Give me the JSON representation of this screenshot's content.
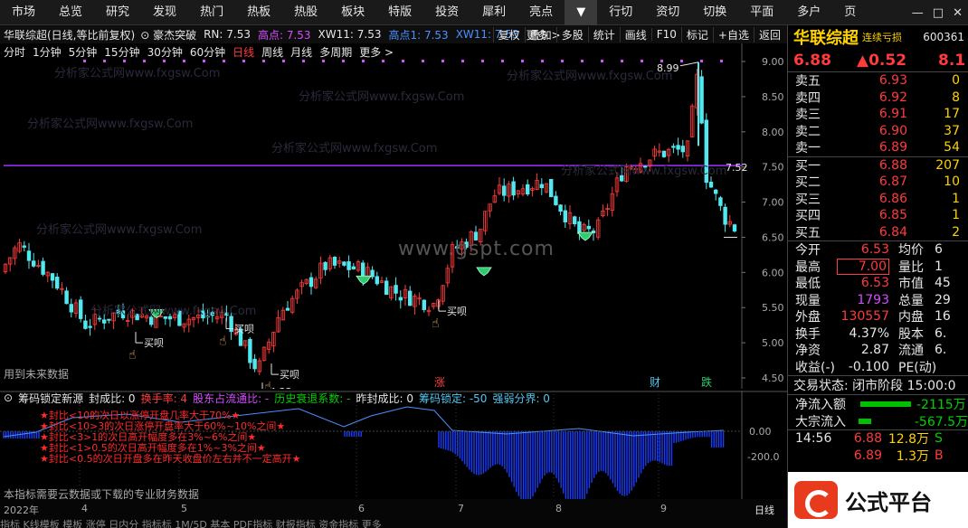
{
  "top_menu": [
    "市场",
    "总览",
    "研究",
    "发现",
    "热门",
    "热板",
    "热股",
    "板块",
    "特版",
    "投资",
    "犀利",
    "亮点",
    "▼",
    "行切",
    "资切",
    "切换",
    "平面",
    "多户",
    "页"
  ],
  "window_controls": [
    "—",
    "□",
    "✕"
  ],
  "toolbar": {
    "title": "华联综超(日线,等比前复权)",
    "indicator": "豪杰突破",
    "rn": "RN: 7.53",
    "high": "高点: 7.53",
    "xw": "XW11: 7.53",
    "high2": "高点1: 7.53",
    "xw2": "XW11: 7.53",
    "more": "更多 >",
    "right_buttons": [
      "复权",
      "叠加",
      "多股",
      "统计",
      "画线",
      "F10",
      "标记",
      "+自选",
      "返回"
    ]
  },
  "periods": [
    "分时",
    "1分钟",
    "5分钟",
    "15分钟",
    "30分钟",
    "60分钟",
    "日线",
    "周线",
    "月线",
    "多周期",
    "更多 >"
  ],
  "active_period": "日线",
  "main_chart": {
    "y_labels": [
      "9.00",
      "8.50",
      "8.00",
      "7.50",
      "7.00",
      "6.50",
      "6.00",
      "5.50",
      "5.00",
      "4.50"
    ],
    "hline_label": "7.52",
    "annotations": {
      "high": "8.99",
      "low": "4.33",
      "buy": "买呗",
      "future_note": "用到未来数据",
      "markers": [
        "涨",
        "财",
        "跌"
      ]
    },
    "watermark": "分析家公式网www.fxgsw.Com",
    "site_watermark": "www.gspt.com"
  },
  "sub_chart": {
    "header": {
      "name": "筹码锁定新源",
      "seal": "封成比: 0",
      "turnover": "换手率: 4",
      "float": "股东占流通比: -",
      "history": "历史衰退系数: -",
      "prev": "昨封成比: 0",
      "lock": "筹码锁定: -50",
      "boundary": "强弱分界: 0"
    },
    "y_labels": [
      "0.00",
      "-200.0"
    ],
    "notes": [
      "★封比<10的次日以涨停开盘几率大于70%★",
      "★封比<10>3的次日涨停开盘率大于60%~10%之间★",
      "★封比<3>1的次日高开幅度多在3%~6%之间★",
      "★封比<1>0.5的次日高开幅度多在1%~3%之间★",
      "★封比<0.5的次日开盘多在昨天收盘价左右并不一定高开★"
    ],
    "footer_note": "本指标需要云数据或下载的专业财务数据"
  },
  "bottom": {
    "year": "2022年",
    "months": [
      "4",
      "5",
      "6",
      "7",
      "8",
      "9"
    ],
    "tab": "日线",
    "line2": "指标 K线模板 模板 涨停 日内分 指标标 1M/5D 基本 PDF指标 财报指标 资金指标 更多"
  },
  "quote": {
    "name": "华联综超",
    "tag": "连续亏损",
    "code": "600361",
    "price": "6.88",
    "change": "▲0.52",
    "pct": "8.1",
    "asks": [
      {
        "label": "卖五",
        "price": "6.93",
        "vol": "0"
      },
      {
        "label": "卖四",
        "price": "6.92",
        "vol": "8"
      },
      {
        "label": "卖三",
        "price": "6.91",
        "vol": "17"
      },
      {
        "label": "卖二",
        "price": "6.90",
        "vol": "37"
      },
      {
        "label": "卖一",
        "price": "6.89",
        "vol": "54"
      }
    ],
    "bids": [
      {
        "label": "买一",
        "price": "6.88",
        "vol": "207"
      },
      {
        "label": "买二",
        "price": "6.87",
        "vol": "10"
      },
      {
        "label": "买三",
        "price": "6.86",
        "vol": "1"
      },
      {
        "label": "买四",
        "price": "6.85",
        "vol": "1"
      },
      {
        "label": "买五",
        "price": "6.84",
        "vol": "2"
      }
    ],
    "stats": [
      {
        "l1": "今开",
        "v1": "6.53",
        "c1": "red",
        "l2": "均价",
        "v2": "6"
      },
      {
        "l1": "最高",
        "v1": "7.00",
        "c1": "red",
        "l2": "量比",
        "v2": "1"
      },
      {
        "l1": "最低",
        "v1": "6.53",
        "c1": "red",
        "l2": "市值",
        "v2": "45"
      },
      {
        "l1": "现量",
        "v1": "1793",
        "c1": "purple",
        "l2": "总量",
        "v2": "29"
      },
      {
        "l1": "外盘",
        "v1": "130557",
        "c1": "red",
        "l2": "内盘",
        "v2": "16"
      },
      {
        "l1": "换手",
        "v1": "4.37%",
        "c1": "white",
        "l2": "股本",
        "v2": "6."
      },
      {
        "l1": "净资",
        "v1": "2.87",
        "c1": "white",
        "l2": "流通",
        "v2": "6."
      },
      {
        "l1": "收益(-)",
        "v1": "-0.100",
        "c1": "white",
        "l2": "PE(动)",
        "v2": ""
      }
    ],
    "trade_state": "交易状态: 闭市阶段 15:00:0",
    "net_inflow": {
      "label": "净流入额",
      "value": "-2115万"
    },
    "big_inflow": {
      "label": "大宗流入",
      "value": "-567.5万"
    },
    "ticks": [
      {
        "time": "14:56",
        "price": "6.88",
        "vol": "12.8万",
        "side": "S"
      },
      {
        "time": "",
        "price": "6.89",
        "vol": "1.3万",
        "side": "B"
      }
    ],
    "logo_text": "公式平台"
  },
  "colors": {
    "up": "#ff3b3b",
    "down": "#52e8f0",
    "hline": "#9b30ff",
    "sub_line": "#4a90ff",
    "sub_bar": "#1a3cff"
  }
}
